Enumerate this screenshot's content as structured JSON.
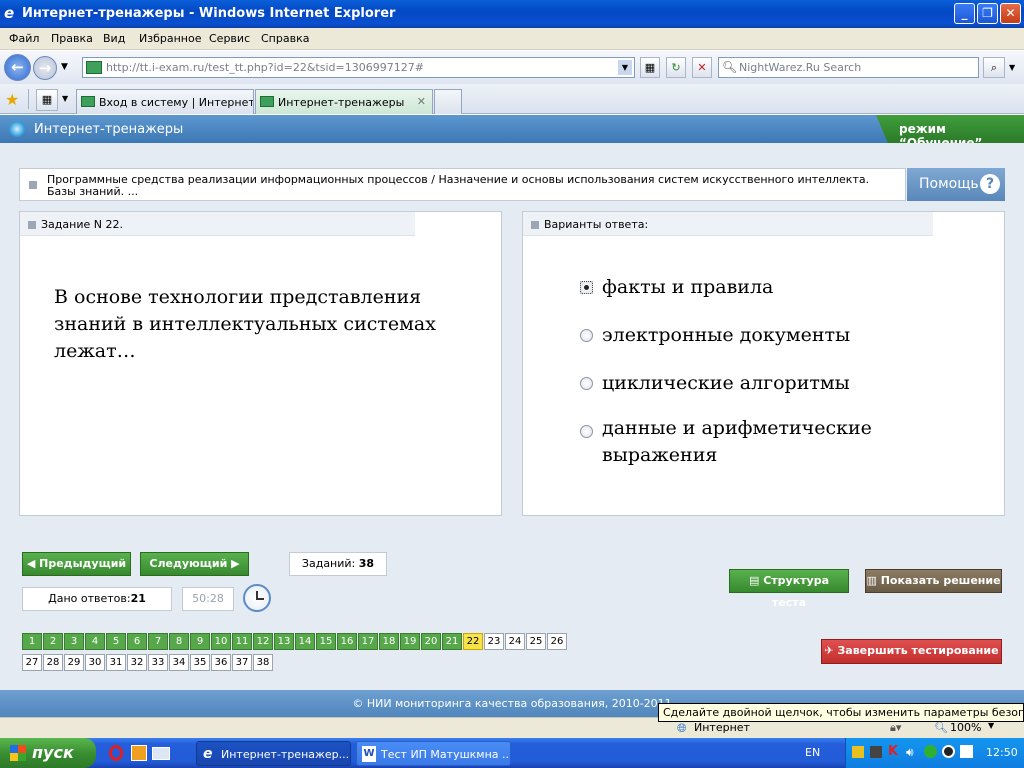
{
  "window": {
    "title": "Интернет-тренажеры - Windows Internet Explorer"
  },
  "menu": [
    "Файл",
    "Правка",
    "Вид",
    "Избранное",
    "Сервис",
    "Справка"
  ],
  "address": {
    "url": "http://tt.i-exam.ru/test_tt.php?id=22&tsid=1306997127#"
  },
  "search": {
    "placeholder": "NightWarez.Ru Search"
  },
  "tabs": [
    {
      "label": "Вход в систему | Интернет-..."
    },
    {
      "label": "Интернет-тренажеры"
    }
  ],
  "app": {
    "name": "Интернет-тренажеры",
    "mode": "режим “Обучение”"
  },
  "topic": "Программные средства реализации информационных процессов / Назначение и основы использования систем искусственного интеллекта. Базы знаний. ...",
  "help_label": "Помощь",
  "task": {
    "header": "Задание N 22.",
    "question": "В основе технологии представления знаний в интеллектуальных системах лежат…"
  },
  "answers": {
    "header": "Варианты ответа:",
    "options": [
      "факты и правила",
      "электронные документы",
      "циклические алгоритмы",
      "данные и арифметические выражения"
    ],
    "selected_index": 0
  },
  "nav": {
    "prev": "Предыдущий",
    "next": "Следующий",
    "tasks_label": "Заданий:",
    "tasks_count": "38",
    "answered_label": "Дано ответов:",
    "answered_count": "21",
    "timer": "50:28",
    "structure": "Структура теста",
    "show_solution": "Показать решение",
    "finish": "Завершить тестирование"
  },
  "question_numbers": {
    "total": 38,
    "answered_through": 21,
    "current": 22
  },
  "footer": "© НИИ мониторинга качества образования, 2010-2011",
  "tooltip": "Сделайте двойной щелчок, чтобы изменить параметры безопасности",
  "status": {
    "zone": "Интернет",
    "zoom": "100%"
  },
  "taskbar": {
    "start": "пуск",
    "items": [
      "Интернет-тренажер...",
      "Тест ИП Матушкмна ..."
    ],
    "lang": "EN",
    "clock": "12:50"
  }
}
